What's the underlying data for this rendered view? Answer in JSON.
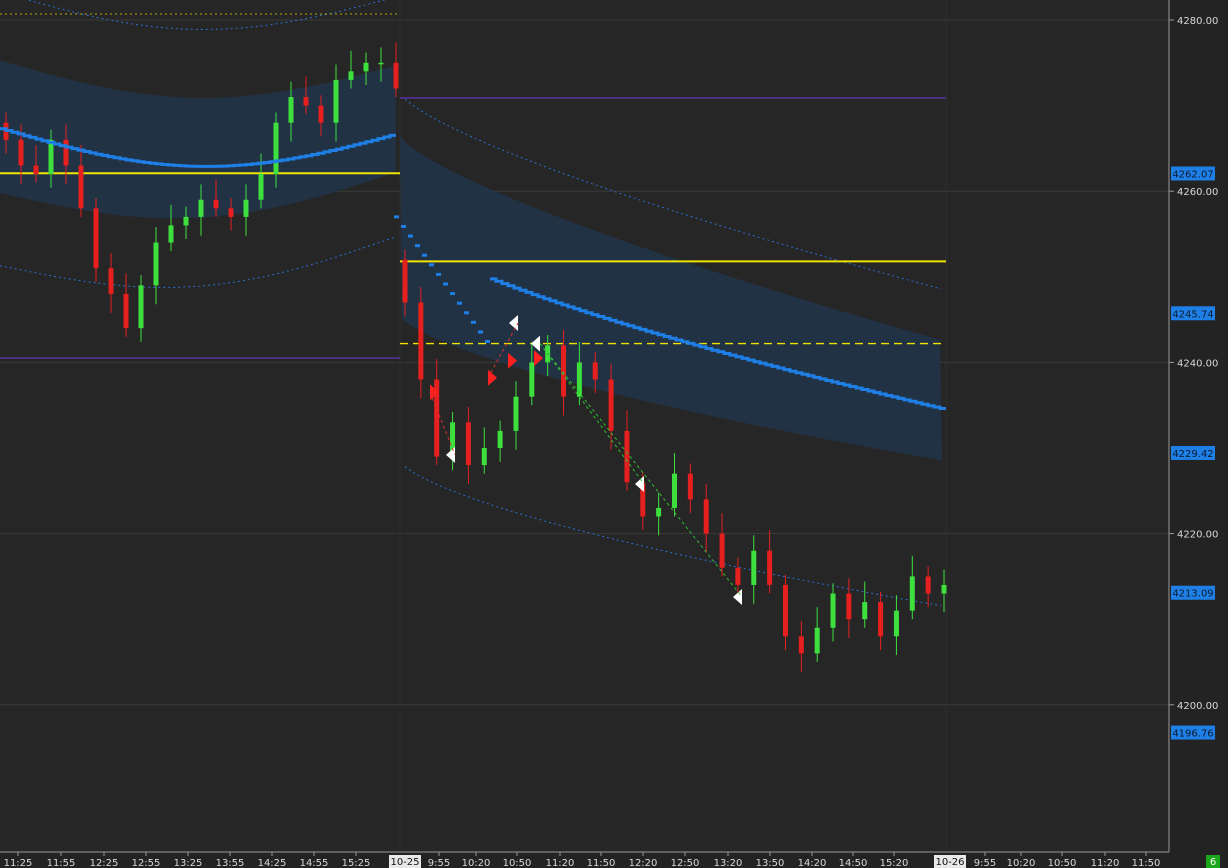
{
  "chart_data": {
    "type": "candlestick",
    "title": "",
    "xlabel": "",
    "ylabel": "",
    "ylim": [
      4183.5,
      4282
    ],
    "grid": true,
    "legend": "none",
    "colors": {
      "background": "#262626",
      "grid": "#3a3a3a",
      "up": "#3ee03e",
      "down": "#e61f1f",
      "wick": "#cfcfcf",
      "vwap": "#1e7fe6",
      "band_fill": "#223449",
      "band_dots": "#2a6fd0",
      "level_yellow": "#f0e400",
      "level_purple": "#5b2fa3",
      "tag_fill": "#1e7fe6",
      "signal_red": "#ff2020",
      "signal_white": "#ffffff"
    },
    "y_ticks": [
      "4280.00",
      "4260.00",
      "4240.00",
      "4220.00",
      "4200.00"
    ],
    "price_tags": [
      "4262.07",
      "4245.74",
      "4229.42",
      "4213.09",
      "4196.76"
    ],
    "badge": "6",
    "date_labels": [
      "10-25",
      "10-26"
    ],
    "x_labels": {
      "day1": [
        "11:25",
        "11:55",
        "12:25",
        "12:55",
        "13:25",
        "13:55",
        "14:25",
        "14:55",
        "15:25"
      ],
      "day2": [
        "9:55",
        "10:20",
        "10:50",
        "11:20",
        "11:50",
        "12:20",
        "12:50",
        "13:20",
        "13:50",
        "14:20",
        "14:50",
        "15:20"
      ],
      "day3": [
        "9:55",
        "10:20",
        "10:50",
        "11:20",
        "11:50"
      ]
    },
    "levels": [
      {
        "price": 4262.1,
        "style": "solid",
        "color": "yellow",
        "segment": "day1"
      },
      {
        "price": 4251.8,
        "style": "solid",
        "color": "yellow",
        "segment": "day2"
      },
      {
        "price": 4242.2,
        "style": "dashed",
        "color": "yellow",
        "segment": "day2"
      },
      {
        "price": 4270.9,
        "style": "solid",
        "color": "purple",
        "segment": "day2"
      },
      {
        "price": 4240.5,
        "style": "solid",
        "color": "purple",
        "segment": "day1"
      }
    ],
    "day1_close": [
      4266,
      4263,
      4262,
      4266,
      4263,
      4258,
      4251,
      4248,
      4244,
      4249,
      4254,
      4256,
      4257,
      4259,
      4258,
      4257,
      4259,
      4262,
      4268,
      4271,
      4270,
      4268,
      4273,
      4274,
      4275,
      4275,
      4272
    ],
    "day2_close": [
      4247,
      4238,
      4229,
      4233,
      4228,
      4230,
      4232,
      4236,
      4240,
      4242,
      4236,
      4240,
      4238,
      4232,
      4226,
      4222,
      4223,
      4227,
      4224,
      4220,
      4216,
      4214,
      4218,
      4214,
      4208,
      4206,
      4209,
      4213,
      4210,
      4212,
      4208,
      4211,
      4215,
      4213,
      4214
    ]
  }
}
